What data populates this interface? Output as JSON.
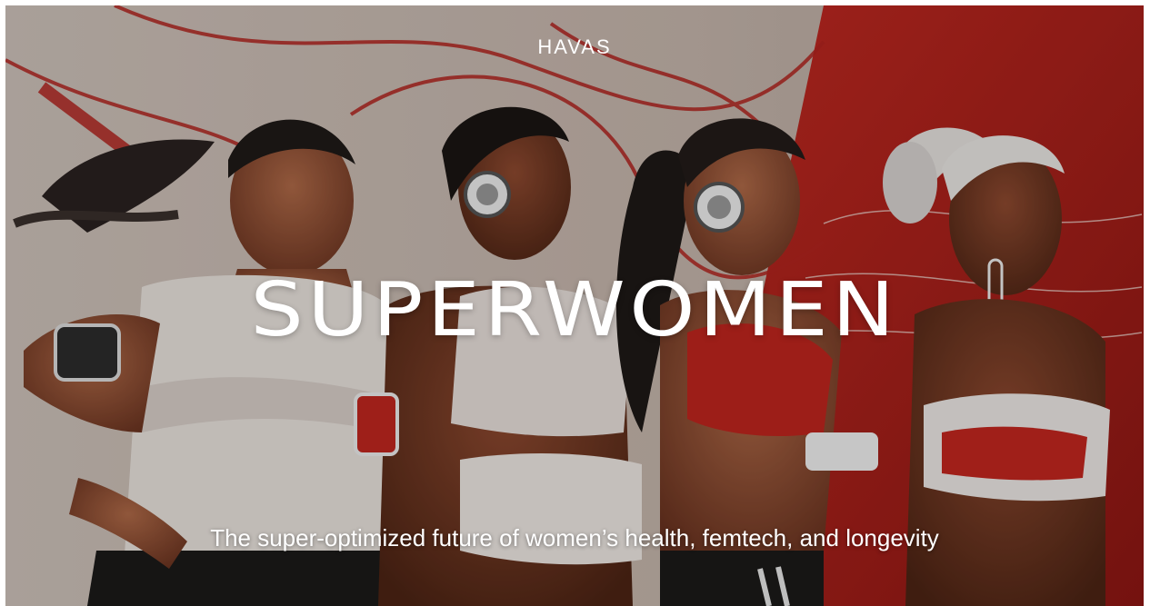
{
  "brand": {
    "logo_text": "HAVAS"
  },
  "hero": {
    "title": "SUPERWOMEN",
    "subtitle": "The super-optimized future of women’s health, femtech, and longevity"
  },
  "colors": {
    "background_light": "#c9bdb4",
    "accent_red": "#b3241f",
    "skin_dark": "#7a3c26",
    "text": "#ffffff"
  }
}
